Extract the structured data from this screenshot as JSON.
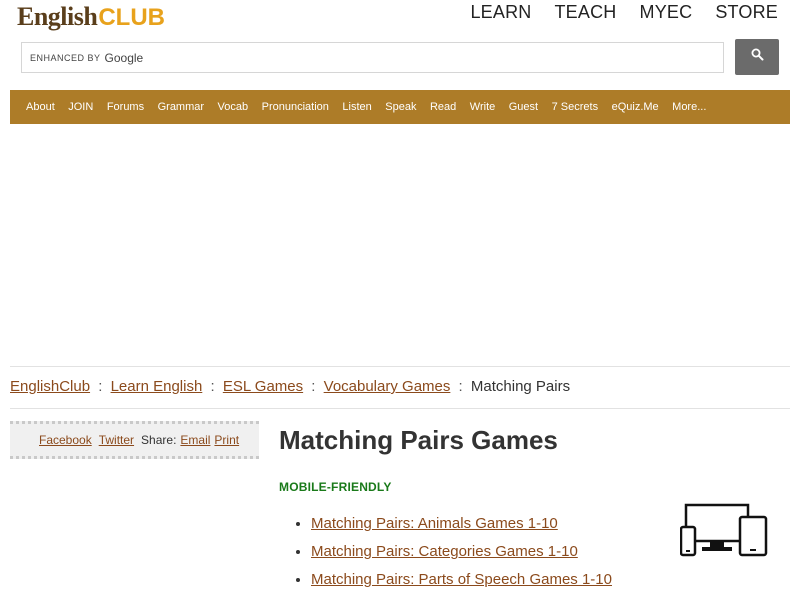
{
  "header": {
    "logo_english": "English",
    "logo_club": "CLUB",
    "top_nav": [
      "LEARN",
      "TEACH",
      "MYEC",
      "STORE"
    ]
  },
  "search": {
    "prefix": "ENHANCED BY",
    "brand": "Google",
    "value": "",
    "button_icon": "search-icon"
  },
  "nav": {
    "items": [
      "About",
      "JOIN",
      "Forums",
      "Grammar",
      "Vocab",
      "Pronunciation",
      "Listen",
      "Speak",
      "Read",
      "Write",
      "Guest",
      "7 Secrets",
      "eQuiz.Me",
      "More..."
    ]
  },
  "breadcrumb": {
    "items": [
      "EnglishClub",
      "Learn English",
      "ESL Games",
      "Vocabulary Games"
    ],
    "separator": ":",
    "current": "Matching Pairs"
  },
  "share": {
    "facebook": "Facebook",
    "twitter": "Twitter",
    "share_label": "Share:",
    "email": "Email",
    "print": "Print"
  },
  "content": {
    "title": "Matching Pairs Games",
    "mobile_label": "MOBILE-FRIENDLY",
    "games": [
      "Matching Pairs: Animals Games 1-10",
      "Matching Pairs: Categories Games 1-10",
      "Matching Pairs: Parts of Speech Games 1-10"
    ],
    "devices_icon": "devices-icon"
  },
  "colors": {
    "nav_bg": "#ad7c28",
    "link": "#8b4a1c",
    "logo_english": "#5a3e1b",
    "logo_club": "#e8a21c",
    "mobile_label": "#1a7a1a",
    "search_button": "#6b6b6b"
  }
}
